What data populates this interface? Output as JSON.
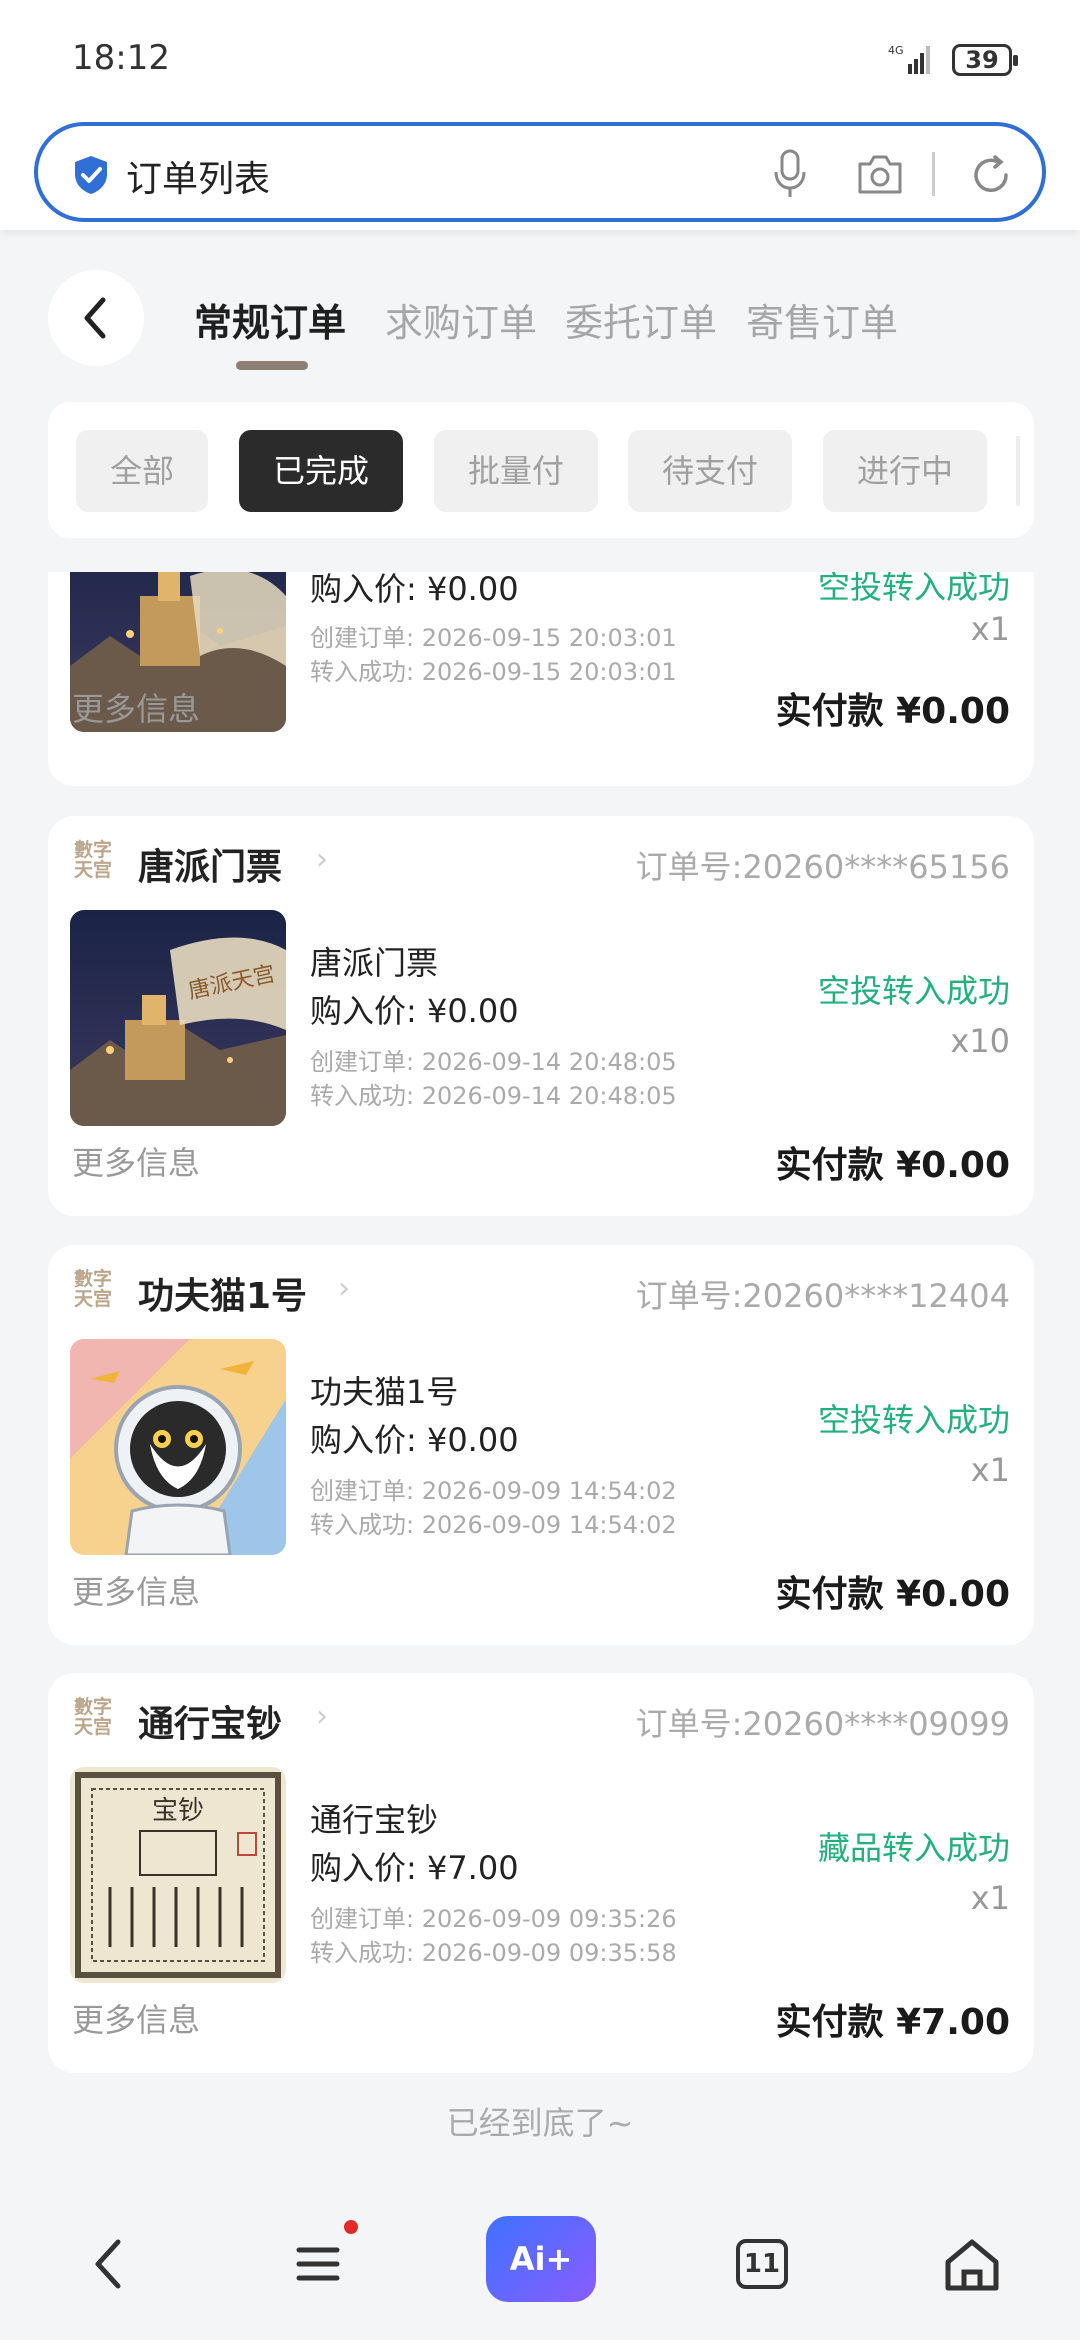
{
  "status_bar": {
    "time": "18:12",
    "network": "4G",
    "battery": "39"
  },
  "search_bar": {
    "text": "订单列表"
  },
  "tabs": [
    {
      "label": "常规订单",
      "active": true
    },
    {
      "label": "求购订单",
      "active": false
    },
    {
      "label": "委托订单",
      "active": false
    },
    {
      "label": "寄售订单",
      "active": false
    }
  ],
  "filters": [
    {
      "label": "全部",
      "active": false
    },
    {
      "label": "已完成",
      "active": true
    },
    {
      "label": "批量付",
      "active": false
    },
    {
      "label": "待支付",
      "active": false
    },
    {
      "label": "进行中",
      "active": false
    }
  ],
  "orders": [
    {
      "title": "",
      "order_no": "",
      "name": "",
      "price": "购入价: ¥0.00",
      "created": "创建订单: 2026-09-15 20:03:01",
      "transferred": "转入成功: 2026-09-15 20:03:01",
      "status": "空投转入成功",
      "qty": "x1",
      "more": "更多信息",
      "paid": "实付款 ¥0.00"
    },
    {
      "logo": "數字天宫",
      "title": "唐派门票",
      "order_no": "订单号:20260****65156",
      "name": "唐派门票",
      "price": "购入价: ¥0.00",
      "created": "创建订单: 2026-09-14 20:48:05",
      "transferred": "转入成功: 2026-09-14 20:48:05",
      "status": "空投转入成功",
      "qty": "x10",
      "more": "更多信息",
      "paid": "实付款 ¥0.00",
      "image_text": "唐派天宫"
    },
    {
      "logo": "數字天宫",
      "title": "功夫猫1号",
      "order_no": "订单号:20260****12404",
      "name": "功夫猫1号",
      "price": "购入价: ¥0.00",
      "created": "创建订单: 2026-09-09 14:54:02",
      "transferred": "转入成功: 2026-09-09 14:54:02",
      "status": "空投转入成功",
      "qty": "x1",
      "more": "更多信息",
      "paid": "实付款 ¥0.00"
    },
    {
      "logo": "數字天宫",
      "title": "通行宝钞",
      "order_no": "订单号:20260****09099",
      "name": "通行宝钞",
      "price": "购入价: ¥7.00",
      "created": "创建订单: 2026-09-09 09:35:26",
      "transferred": "转入成功: 2026-09-09 09:35:58",
      "status": "藏品转入成功",
      "qty": "x1",
      "more": "更多信息",
      "paid": "实付款 ¥7.00",
      "image_text": "宝钞"
    }
  ],
  "end_note": "已经到底了~",
  "nav": {
    "ai_label": "Ai+",
    "tabs_count": "11"
  },
  "colors": {
    "accent_blue": "#2f6fd6",
    "success_green": "#22b07d",
    "tab_underline": "#8d7d72"
  }
}
